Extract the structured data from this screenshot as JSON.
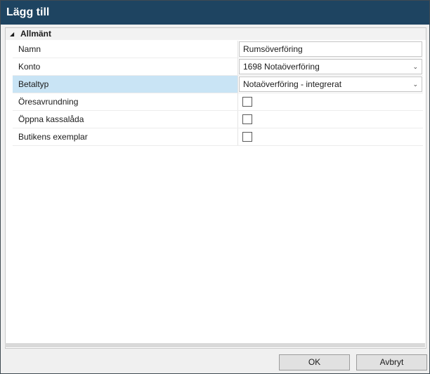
{
  "window": {
    "title": "Lägg till"
  },
  "group": {
    "label": "Allmänt",
    "expander_icon": "collapse-triangle-icon"
  },
  "fields": {
    "namn": {
      "label": "Namn",
      "value": "Rumsöverföring"
    },
    "konto": {
      "label": "Konto",
      "value": "1698 Notaöverföring"
    },
    "betaltyp": {
      "label": "Betaltyp",
      "value": "Notaöverföring - integrerat"
    },
    "oresavrundning": {
      "label": "Öresavrundning",
      "checked": false
    },
    "oppna_kassalada": {
      "label": "Öppna kassalåda",
      "checked": false
    },
    "butikens_exemplar": {
      "label": "Butikens exemplar",
      "checked": false
    }
  },
  "buttons": {
    "ok": "OK",
    "cancel": "Avbryt"
  },
  "colors": {
    "titlebar": "#1e4461",
    "selected_row": "#c9e4f5"
  }
}
